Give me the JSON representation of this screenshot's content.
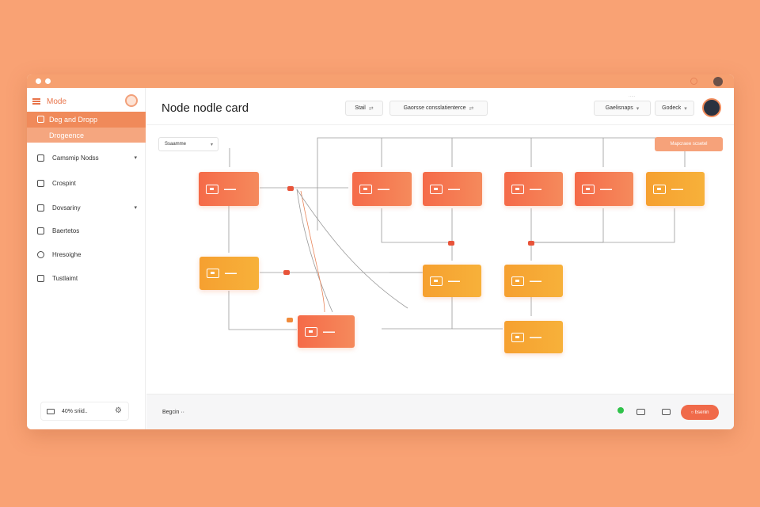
{
  "colors": {
    "accent": "#f08a5a",
    "node_red": "#f56a48",
    "node_orange": "#f6a030",
    "status_green": "#2fc24a",
    "background": "#f9a274"
  },
  "sidebar": {
    "brand": "Mode",
    "active_items": [
      {
        "label": "Deg and Dropp",
        "icon": "drag-icon"
      },
      {
        "label": "Drogeence",
        "icon": "layers-icon"
      }
    ],
    "items": [
      {
        "label": "Camsmip Nodss",
        "icon": "box-icon",
        "chevron": "▾"
      },
      {
        "label": "Crospint",
        "icon": "list-icon",
        "chevron": ""
      },
      {
        "label": "Dovsariny",
        "icon": "folder-icon",
        "chevron": "▾"
      },
      {
        "label": "Baertetos",
        "icon": "document-icon",
        "chevron": ""
      },
      {
        "label": "Hresoighe",
        "icon": "move-icon",
        "chevron": ""
      },
      {
        "label": "Tustlaimt",
        "icon": "lock-icon",
        "chevron": ""
      }
    ],
    "footer": {
      "label": "40% sriid..",
      "icon": "image-icon",
      "gear_icon": "gear-icon"
    }
  },
  "header": {
    "title": "Node nodle card",
    "buttons": [
      {
        "label": "Stail",
        "suffix": "⇄"
      },
      {
        "label": "Gaorsse consslatienterce",
        "suffix": "⇄"
      },
      {
        "label": "Gaelisnaps",
        "suffix": "▾"
      },
      {
        "label": "Godeck",
        "suffix": "▾"
      }
    ]
  },
  "canvas": {
    "filter": {
      "label": "Ssaamme",
      "arrow": "▾"
    },
    "action_button": "Mapcraee scsetel"
  },
  "bottom_bar": {
    "label": "Begcin ··",
    "button": "○ bsenin"
  }
}
